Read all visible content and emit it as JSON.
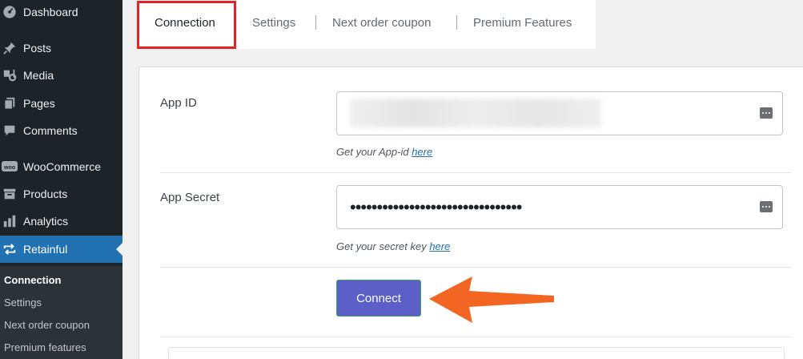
{
  "sidebar": {
    "items": [
      {
        "label": "Dashboard",
        "icon": "dashboard-icon"
      },
      {
        "label": "Posts",
        "icon": "pin-icon"
      },
      {
        "label": "Media",
        "icon": "media-icon"
      },
      {
        "label": "Pages",
        "icon": "pages-icon"
      },
      {
        "label": "Comments",
        "icon": "comment-icon"
      },
      {
        "label": "WooCommerce",
        "icon": "woo-icon"
      },
      {
        "label": "Products",
        "icon": "archive-icon"
      },
      {
        "label": "Analytics",
        "icon": "chart-bar-icon"
      },
      {
        "label": "Retainful",
        "icon": "repeat-icon"
      }
    ],
    "submenu": [
      "Connection",
      "Settings",
      "Next order coupon",
      "Premium features"
    ]
  },
  "tabs": [
    "Connection",
    "Settings",
    "Next order coupon",
    "Premium Features"
  ],
  "form": {
    "app_id_label": "App ID",
    "app_id_hint": "Get your App-id ",
    "app_id_link": "here",
    "secret_label": "App Secret",
    "secret_value": "••••••••••••••••••••••••••••••••",
    "secret_hint": "Get your secret key ",
    "secret_link": "here",
    "connect_label": "Connect"
  },
  "colors": {
    "sidebar_bg": "#1d2327",
    "active_menu": "#2271b1",
    "connect_button": "#5b5fc7",
    "arrow": "#f26522",
    "highlight_box": "#e02424"
  }
}
